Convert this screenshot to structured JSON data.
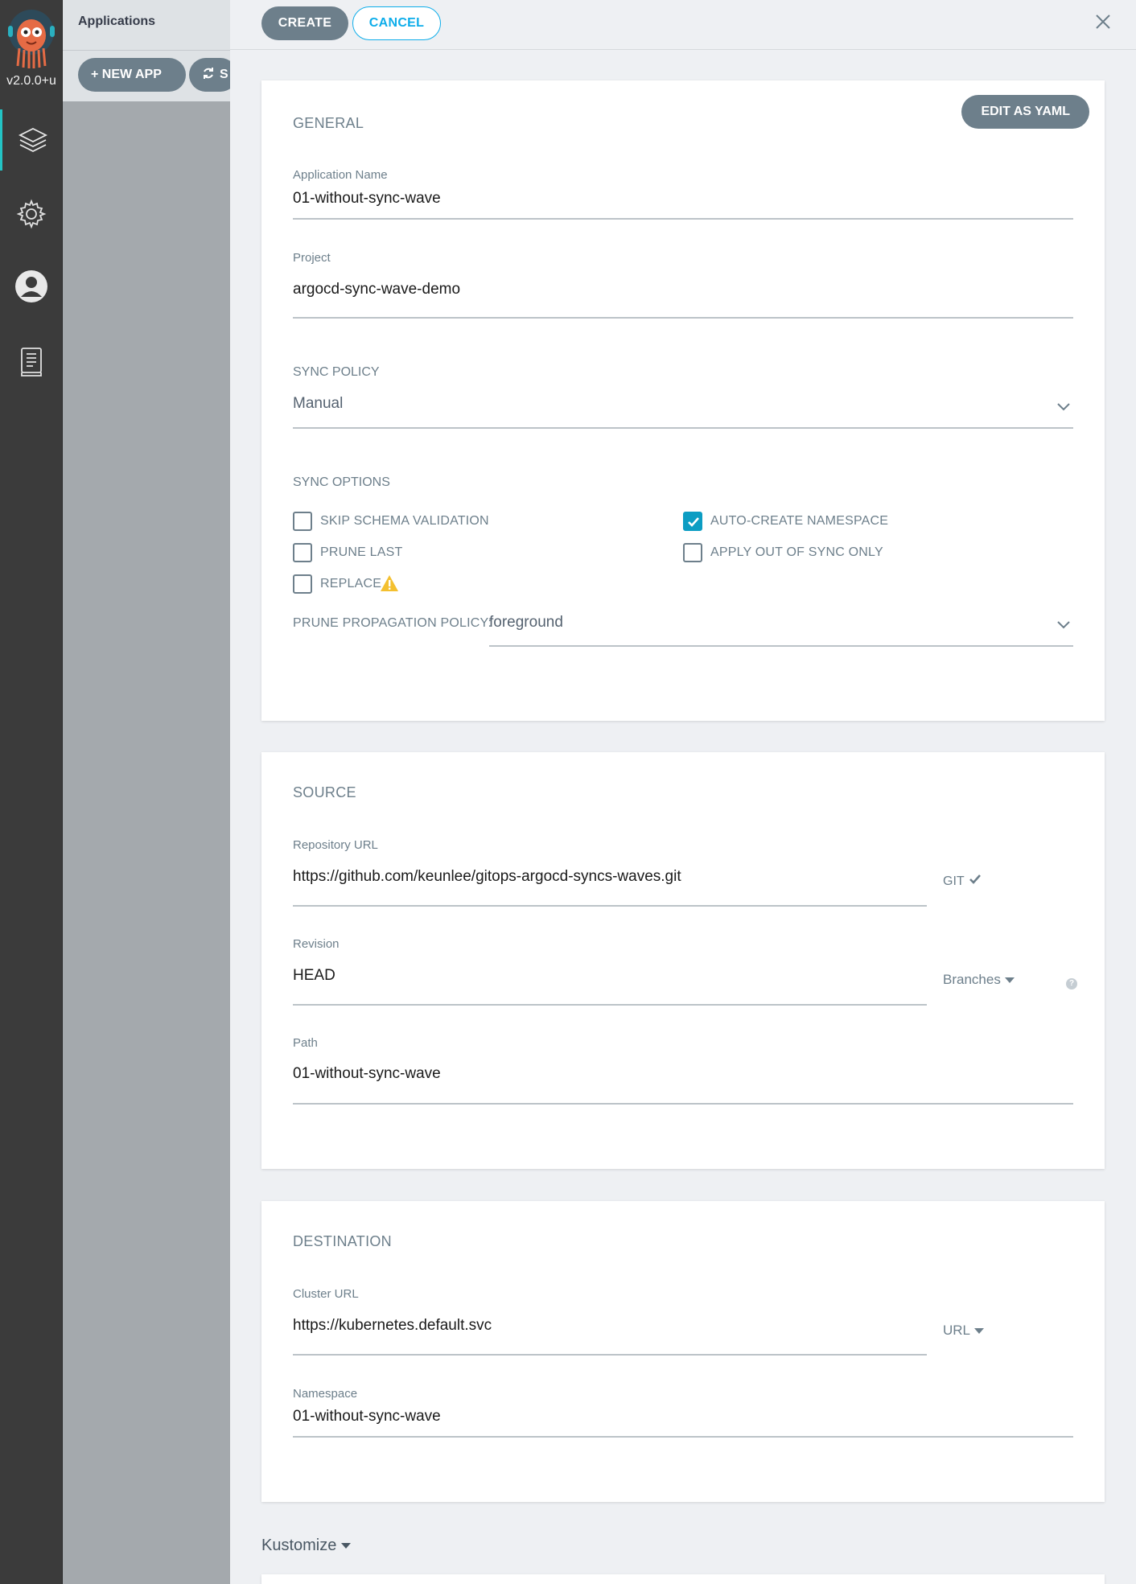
{
  "nav": {
    "version": "v2.0.0+u",
    "items": [
      {
        "icon": "layers-icon",
        "active": true
      },
      {
        "icon": "gear-icon",
        "active": false
      },
      {
        "icon": "user-icon",
        "active": false
      },
      {
        "icon": "docs-icon",
        "active": false
      }
    ]
  },
  "appbar": {
    "title": "Applications",
    "new_app_label": "+ NEW APP",
    "sync_label": "S"
  },
  "panel": {
    "create_label": "CREATE",
    "cancel_label": "CANCEL",
    "general": {
      "title": "GENERAL",
      "edit_yaml_label": "EDIT AS YAML",
      "app_name_label": "Application Name",
      "app_name_value": "01-without-sync-wave",
      "project_label": "Project",
      "project_value": "argocd-sync-wave-demo",
      "sync_policy_label": "SYNC POLICY",
      "sync_policy_value": "Manual",
      "sync_options_label": "SYNC OPTIONS",
      "options": {
        "skip_schema": {
          "label": "SKIP SCHEMA VALIDATION",
          "checked": false
        },
        "auto_create_ns": {
          "label": "AUTO-CREATE NAMESPACE",
          "checked": true
        },
        "prune_last": {
          "label": "PRUNE LAST",
          "checked": false
        },
        "apply_out_of_sync": {
          "label": "APPLY OUT OF SYNC ONLY",
          "checked": false
        },
        "replace": {
          "label": "REPLACE",
          "checked": false
        }
      },
      "prune_policy_label": "PRUNE PROPAGATION POLICY:",
      "prune_policy_value": "foreground"
    },
    "source": {
      "title": "SOURCE",
      "repo_label": "Repository URL",
      "repo_value": "https://github.com/keunlee/gitops-argocd-syncs-waves.git",
      "repo_type": "GIT",
      "revision_label": "Revision",
      "revision_value": "HEAD",
      "revision_mode": "Branches",
      "path_label": "Path",
      "path_value": "01-without-sync-wave"
    },
    "destination": {
      "title": "DESTINATION",
      "cluster_label": "Cluster URL",
      "cluster_value": "https://kubernetes.default.svc",
      "cluster_mode": "URL",
      "namespace_label": "Namespace",
      "namespace_value": "01-without-sync-wave"
    },
    "kustomize_label": "Kustomize"
  },
  "colors": {
    "accent": "#0dadea",
    "checkbox_checked": "#0c9dc3",
    "nav_bg": "#3b3b3b",
    "button_gray": "#6d7f8b",
    "warning": "#f4c030"
  }
}
